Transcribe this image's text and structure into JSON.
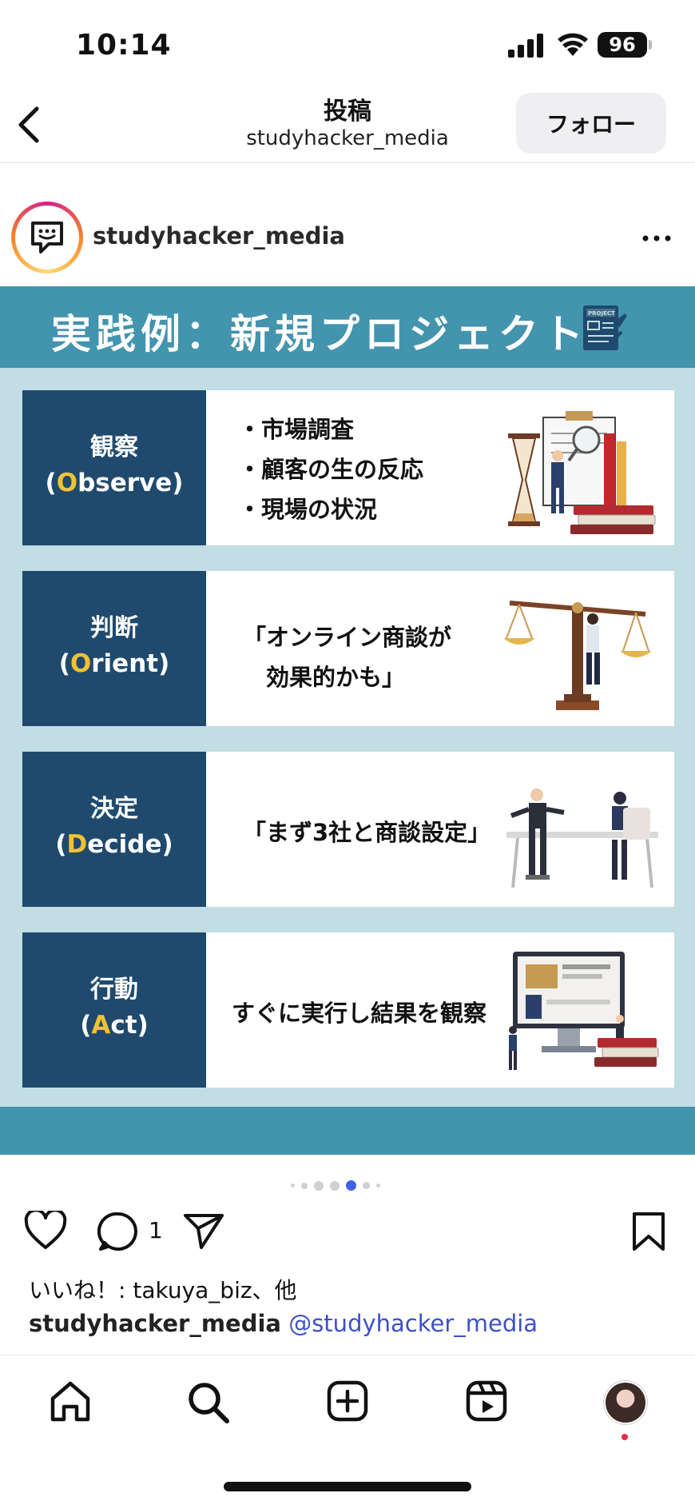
{
  "status": {
    "time": "10:14",
    "battery": "96"
  },
  "header": {
    "title": "投稿",
    "subtitle": "studyhacker_media",
    "follow_label": "フォロー"
  },
  "post": {
    "username": "studyhacker_media",
    "slide_title": "実践例：新規プロジェクト",
    "project_icon_label": "PROJECT",
    "rows": [
      {
        "jp": "観察",
        "en_open": "(",
        "en_initial": "O",
        "en_rest": "bserve)",
        "lines": [
          "・市場調査",
          "・顧客の生の反応",
          "・現場の状況"
        ]
      },
      {
        "jp": "判断",
        "en_open": "(",
        "en_initial": "O",
        "en_rest": "rient)",
        "lines": [
          "「オンライン商談が",
          "　効果的かも」"
        ]
      },
      {
        "jp": "決定",
        "en_open": "(",
        "en_initial": "D",
        "en_rest": "ecide)",
        "lines": [
          "「まず3社と商談設定」"
        ]
      },
      {
        "jp": "行動",
        "en_open": "(",
        "en_initial": "A",
        "en_rest": "ct)",
        "lines": [
          "すぐに実行し結果を観察"
        ]
      }
    ],
    "carousel": {
      "total": 7,
      "active_index": 4
    },
    "comment_count": "1",
    "likes_text": "いいね！: takuya_biz、他",
    "caption_user": "studyhacker_media",
    "caption_mention": "@studyhacker_media"
  },
  "colors": {
    "slide_bg": "#c2dde4",
    "slide_band": "#4394ae",
    "label_bg": "#1f4a6e",
    "highlight": "#f1c232",
    "mention": "#3d50c8"
  },
  "icons": [
    "back-chevron-icon",
    "chat-logo-icon",
    "more-dots-icon",
    "heart-icon",
    "comment-icon",
    "share-icon",
    "bookmark-icon",
    "home-icon",
    "search-icon",
    "create-icon",
    "reels-icon"
  ]
}
